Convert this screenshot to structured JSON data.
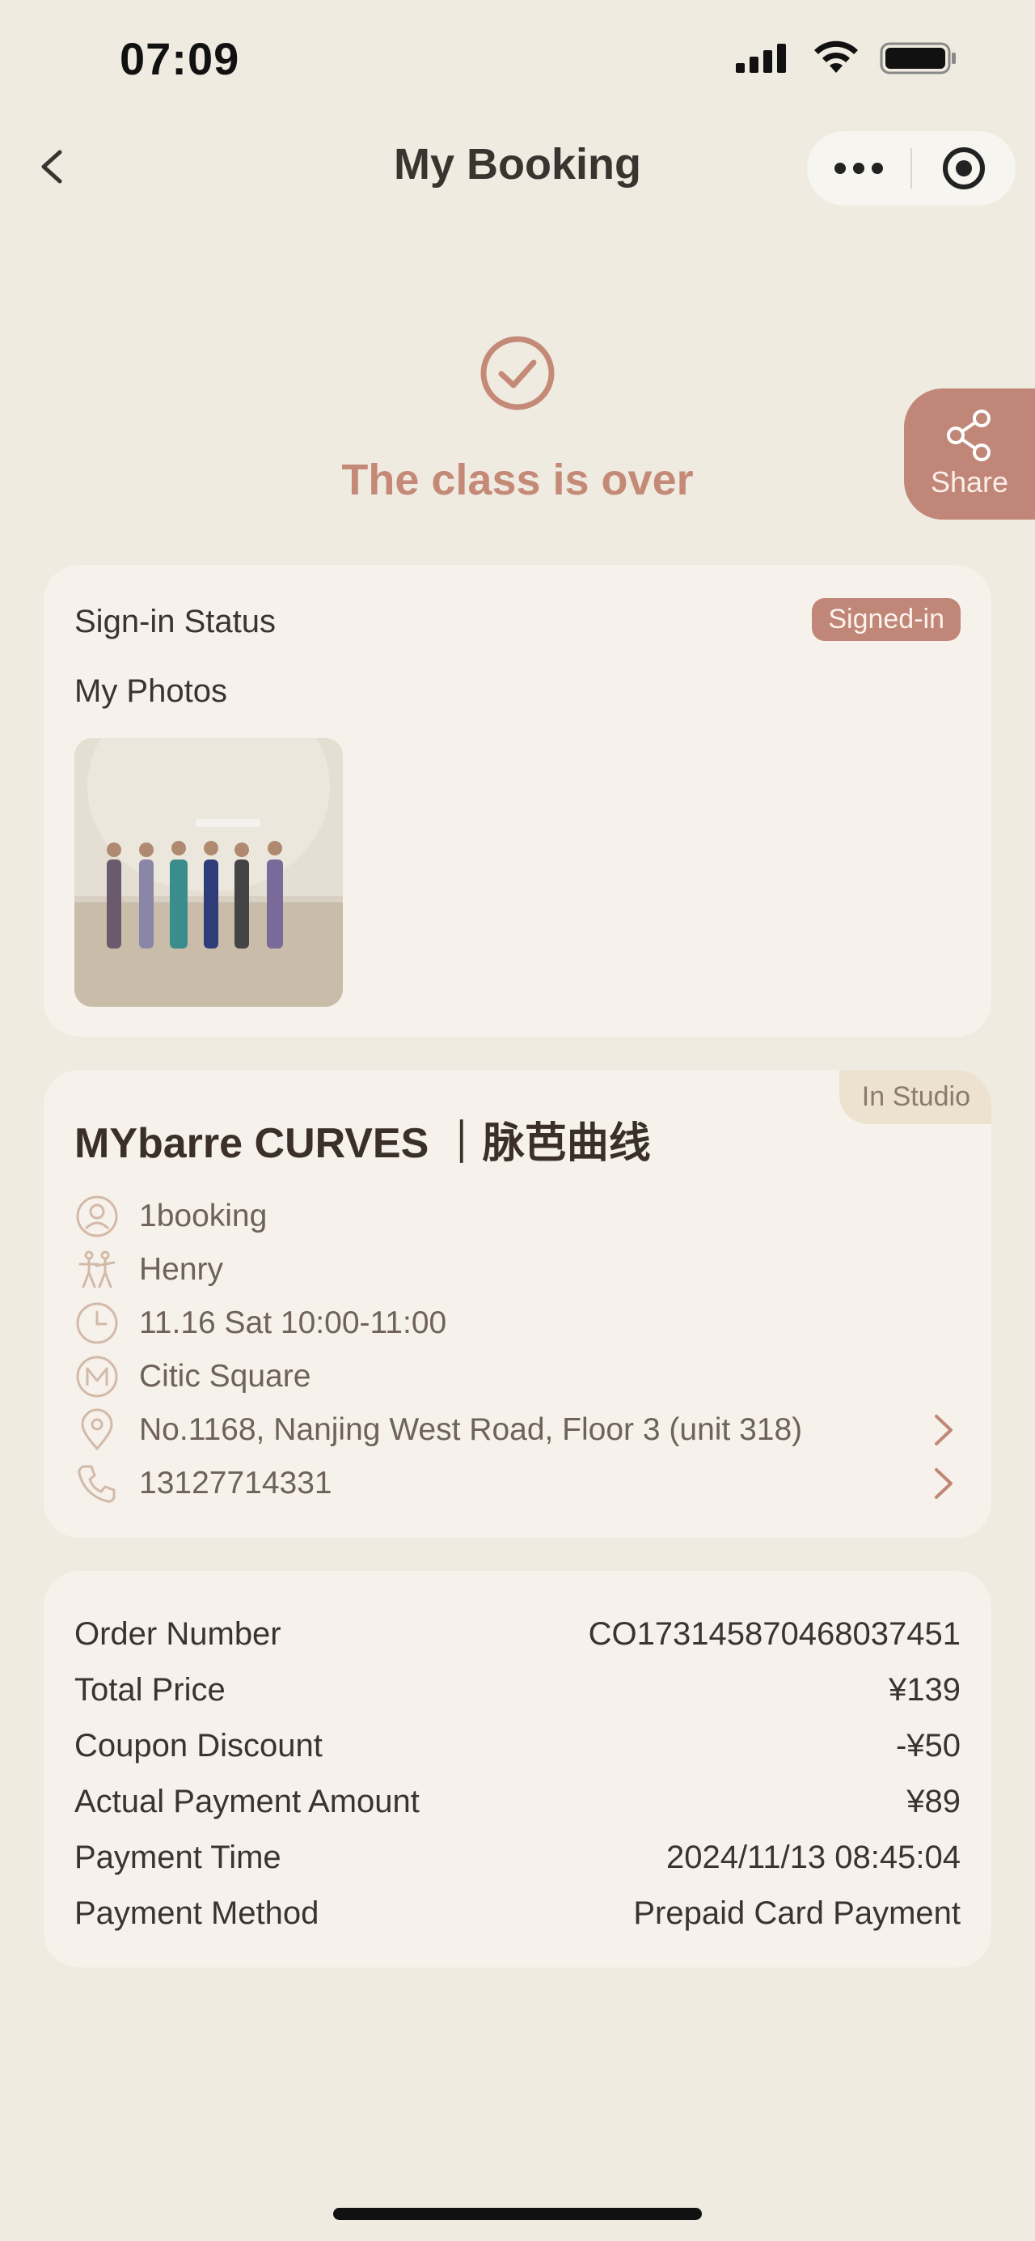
{
  "status_bar": {
    "time": "07:09"
  },
  "nav": {
    "title": "My Booking"
  },
  "hero": {
    "status_text": "The class is over",
    "share_label": "Share"
  },
  "sign_in": {
    "label": "Sign-in Status",
    "badge": "Signed-in",
    "photos_label": "My Photos"
  },
  "class": {
    "title": "MYbarre CURVES ｜脉芭曲线",
    "tag": "In Studio",
    "details": [
      {
        "icon": "user-icon",
        "text": "1booking"
      },
      {
        "icon": "dancer-icon",
        "text": "Henry"
      },
      {
        "icon": "clock-icon",
        "text": "11.16 Sat 10:00-11:00"
      },
      {
        "icon": "studio-logo-icon",
        "text": "Citic Square"
      },
      {
        "icon": "location-pin-icon",
        "text": "No.1168, Nanjing West Road, Floor 3 (unit 318)"
      },
      {
        "icon": "phone-icon",
        "text": "13127714331"
      }
    ]
  },
  "order": {
    "rows": [
      {
        "label": "Order Number",
        "value": "CO173145870468037451"
      },
      {
        "label": "Total Price",
        "value": "¥139"
      },
      {
        "label": "Coupon Discount",
        "value": "-¥50"
      },
      {
        "label": "Actual Payment Amount",
        "value": "¥89"
      },
      {
        "label": "Payment Time",
        "value": "2024/11/13 08:45:04"
      },
      {
        "label": "Payment Method",
        "value": "Prepaid Card Payment"
      }
    ]
  },
  "colors": {
    "accent": "#c08778",
    "background": "#efebe1",
    "card": "#f6f2eb"
  }
}
